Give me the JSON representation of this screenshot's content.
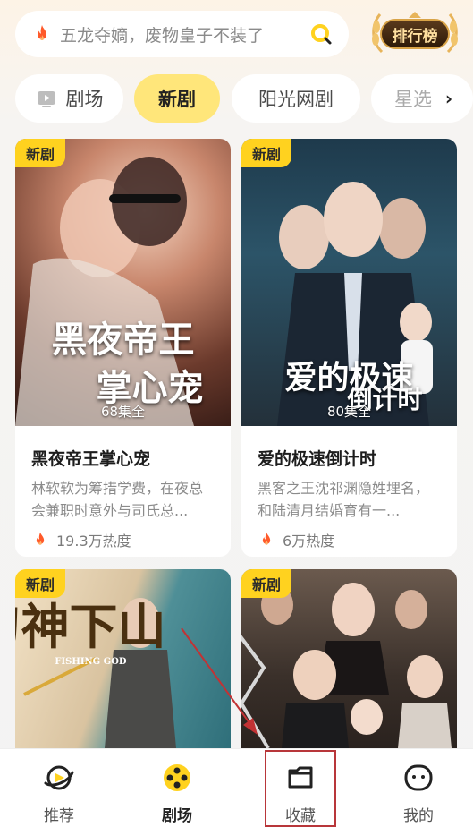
{
  "search": {
    "placeholder": "五龙夺嫡，废物皇子不装了",
    "icon": "fire-icon",
    "button_icon": "search-icon"
  },
  "rank_button": {
    "label": "排行榜"
  },
  "tabs": [
    {
      "label": "剧场",
      "icon": "tv-icon",
      "active": false
    },
    {
      "label": "新剧",
      "active": true
    },
    {
      "label": "阳光网剧",
      "active": false
    },
    {
      "label": "星选",
      "active": false
    }
  ],
  "cards": [
    {
      "badge": "新剧",
      "poster_title": "黑夜帝王掌心宠",
      "poster_title_line1": "黑夜帝王",
      "poster_title_line2": "掌心宠",
      "episodes": "68集全",
      "title": "黑夜帝王掌心宠",
      "desc": "林软软为筹措学费，在夜总会兼职时意外与司氏总...",
      "heat": "19.3万热度"
    },
    {
      "badge": "新剧",
      "poster_title": "爱的极速倒计时",
      "poster_title_line1": "爱的极速",
      "poster_title_line2": "倒计时",
      "episodes": "80集全",
      "title": "爱的极速倒计时",
      "desc": "黑客之王沈祁渊隐姓埋名，和陆清月结婚育有一...",
      "heat": "6万热度"
    },
    {
      "badge": "新剧",
      "poster_title": "刀神下山",
      "poster_subtitle": "FISHING GOD"
    },
    {
      "badge": "新剧"
    }
  ],
  "bottom_nav": [
    {
      "label": "推荐",
      "icon": "planet-icon",
      "active": false
    },
    {
      "label": "剧场",
      "icon": "theater-icon",
      "active": true
    },
    {
      "label": "收藏",
      "icon": "folder-icon",
      "active": false
    },
    {
      "label": "我的",
      "icon": "profile-icon",
      "active": false
    }
  ],
  "colors": {
    "accent_yellow": "#ffd21f",
    "active_tab": "#ffe67a",
    "highlight_box": "#b8363a",
    "fire": "#ff5a2a"
  }
}
